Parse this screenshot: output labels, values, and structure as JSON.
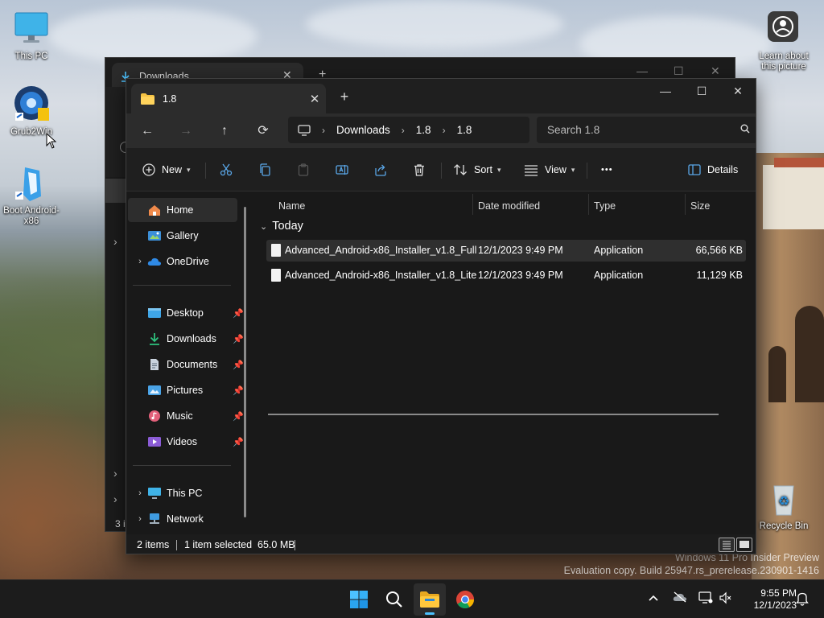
{
  "desktop": {
    "icons": [
      {
        "label": "This PC"
      },
      {
        "label": "Grub2Win"
      },
      {
        "label": "Boot Android-x86"
      },
      {
        "label": "Learn about this picture"
      },
      {
        "label": "Recycle Bin"
      }
    ],
    "watermark": {
      "line1": "Windows 11 Pro Insider Preview",
      "line2": "Evaluation copy. Build 25947.rs_prerelease.230901-1416"
    }
  },
  "background_window": {
    "tab_title": "Downloads",
    "status_fragment": "3 i"
  },
  "window": {
    "tab": {
      "title": "1.8",
      "close": "✕"
    },
    "new_tab": "+",
    "controls": {
      "minimize": "—",
      "maximize": "☐",
      "close": "✕"
    },
    "nav": {
      "back": "←",
      "forward": "→",
      "up": "↑",
      "refresh": "⟳"
    },
    "breadcrumb": [
      "Downloads",
      "1.8",
      "1.8"
    ],
    "search": {
      "placeholder": "Search 1.8"
    },
    "commands": {
      "new": "New",
      "sort": "Sort",
      "view": "View",
      "more": "•••",
      "details": "Details"
    },
    "sidebar": {
      "items": [
        {
          "label": "Home"
        },
        {
          "label": "Gallery"
        },
        {
          "label": "OneDrive"
        },
        {
          "label": "Desktop"
        },
        {
          "label": "Downloads"
        },
        {
          "label": "Documents"
        },
        {
          "label": "Pictures"
        },
        {
          "label": "Music"
        },
        {
          "label": "Videos"
        },
        {
          "label": "This PC"
        },
        {
          "label": "Network"
        }
      ]
    },
    "columns": {
      "name": "Name",
      "date": "Date modified",
      "type": "Type",
      "size": "Size"
    },
    "group": "Today",
    "files": [
      {
        "name": "Advanced_Android-x86_Installer_v1.8_Full",
        "date": "12/1/2023 9:49 PM",
        "type": "Application",
        "size": "66,566 KB"
      },
      {
        "name": "Advanced_Android-x86_Installer_v1.8_Lite",
        "date": "12/1/2023 9:49 PM",
        "type": "Application",
        "size": "11,129 KB"
      }
    ],
    "status": {
      "count": "2 items",
      "selected": "1 item selected  65.0 MB"
    }
  },
  "taskbar": {
    "time": "9:55 PM",
    "date": "12/1/2023"
  },
  "colors": {
    "accent": "#4cc2ff",
    "folder": "#f5c242",
    "window_bg": "#191919"
  }
}
